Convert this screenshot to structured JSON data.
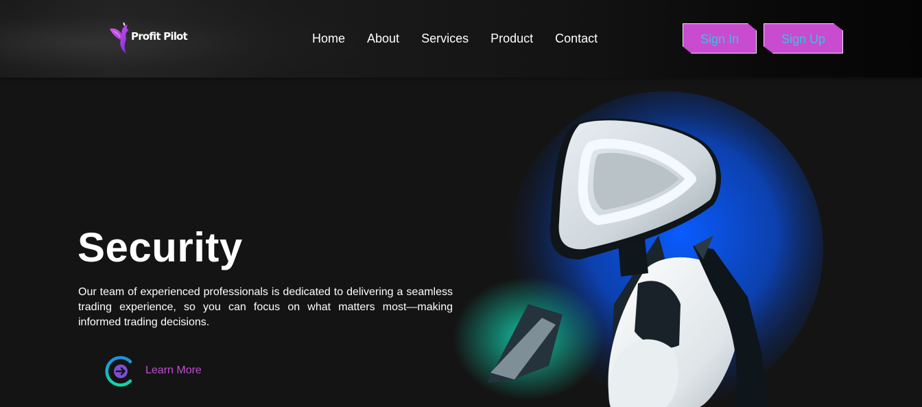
{
  "brand": {
    "name": "Profit Pilot"
  },
  "nav": {
    "items": [
      {
        "label": "Home"
      },
      {
        "label": "About"
      },
      {
        "label": "Services"
      },
      {
        "label": "Product"
      },
      {
        "label": "Contact"
      }
    ]
  },
  "auth": {
    "sign_in_label": "Sign In",
    "sign_up_label": "Sign Up"
  },
  "hero": {
    "title": "Security",
    "description": "Our team of experienced professionals is dedicated to delivering a seamless trading experience, so you can focus on what matters most—making informed trading decisions.",
    "cta_label": "Learn More",
    "cta_icon": "arrow-right-circle-icon"
  },
  "colors": {
    "background": "#141414",
    "accent_magenta": "#c94bcf",
    "button_text_cyan": "#32c7dc",
    "link_purple": "#c04dd0",
    "glow_blue": "#0a5cff",
    "glow_teal": "#14d6b4"
  }
}
